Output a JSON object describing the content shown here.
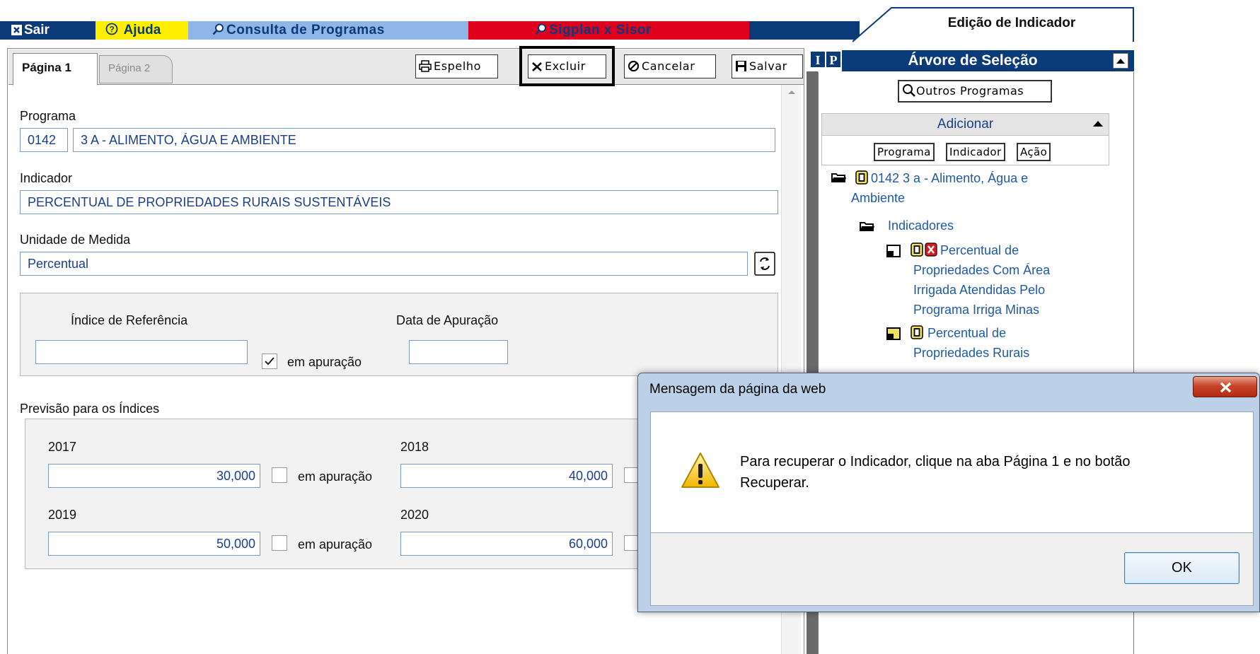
{
  "menu": {
    "sair": "Sair",
    "ajuda": "Ajuda",
    "consulta": "Consulta de Programas",
    "sigplan": "Sigplan x Sisor"
  },
  "header": {
    "title": "Edição de Indicador"
  },
  "tabs": {
    "pagina1": "Página 1",
    "pagina2": "Página 2"
  },
  "toolbar": {
    "espelho": "Espelho",
    "excluir": "Excluir",
    "cancelar": "Cancelar",
    "salvar": "Salvar"
  },
  "form": {
    "programa_label": "Programa",
    "programa_code": "0142",
    "programa_name": "3 A - ALIMENTO, ÁGUA E AMBIENTE",
    "indicador_label": "Indicador",
    "indicador_value": "PERCENTUAL DE PROPRIEDADES RURAIS SUSTENTÁVEIS",
    "unidade_label": "Unidade de Medida",
    "unidade_value": "Percentual",
    "indice_ref_label": "Índice de Referência",
    "indice_ref_value": "",
    "indice_ref_checkbox_label": "em apuração",
    "indice_ref_checked": true,
    "data_apuracao_label": "Data de Apuração",
    "data_apuracao_value": "",
    "previsao_label": "Previsão para os Índices",
    "previsoes": [
      {
        "year": "2017",
        "value": "30,000",
        "checkbox_label": "em apuração",
        "checked": false
      },
      {
        "year": "2018",
        "value": "40,000",
        "checked": false
      },
      {
        "year": "2019",
        "value": "50,000",
        "checkbox_label": "em apuração",
        "checked": false
      },
      {
        "year": "2020",
        "value": "60,000",
        "checked": false
      }
    ]
  },
  "tree": {
    "ip_buttons": [
      "I",
      "P"
    ],
    "title": "Árvore de Seleção",
    "outros_programas": "Outros Programas",
    "adicionar": "Adicionar",
    "add_buttons": [
      "Programa",
      "Indicador",
      "Ação"
    ],
    "programa_node": "0142 3 a - Alimento, Água e Ambiente",
    "programa_node_line1": "0142 3 a - Alimento, Água e",
    "programa_node_line2": "Ambiente",
    "indicadores_node": "Indicadores",
    "items": [
      {
        "lines": [
          "Percentual de",
          "Propriedades Com Área",
          "Irrigada Atendidas Pelo",
          "Programa Irriga Minas"
        ],
        "deleted": true
      },
      {
        "lines": [
          "Percentual de",
          "Propriedades Rurais"
        ],
        "deleted": false
      }
    ]
  },
  "dialog": {
    "title": "Mensagem da página da web",
    "close_label": "X",
    "icon": "warning-icon",
    "message": "Para recuperar o Indicador, clique na aba Página 1 e no botão Recuperar.",
    "message_line1": "Para recuperar o Indicador, clique na aba Página 1 e no botão",
    "message_line2": "Recuperar.",
    "ok": "OK"
  },
  "colors": {
    "navy": "#0b3a78",
    "yellow": "#ffee00",
    "light_blue": "#8fb6e6",
    "red": "#e0001e",
    "link_blue": "#1f5aa6"
  }
}
